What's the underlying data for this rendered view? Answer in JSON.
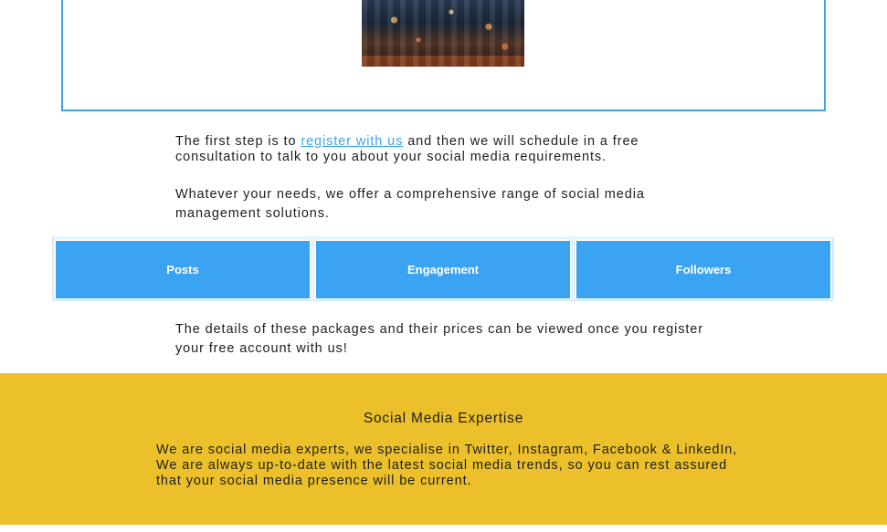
{
  "hero": {
    "image_alt": "city-night-photo"
  },
  "intro": {
    "p1_before": "The first step is to ",
    "p1_link": "register with us",
    "p1_after": " and then we will schedule in a free consultation to talk to you about your social media requirements.",
    "p2": "Whatever your needs, we offer a comprehensive range of social media management solutions."
  },
  "packages": {
    "items": [
      {
        "label": "Posts"
      },
      {
        "label": "Engagement"
      },
      {
        "label": "Followers"
      }
    ],
    "note": "The details of these packages and their prices can be viewed once you register your free account with us!"
  },
  "expertise": {
    "title": "Social Media Expertise",
    "text": "We are social media experts, we specialise in Twitter, Instagram, Facebook & LinkedIn, We are always up-to-date with the latest social media trends, so you can rest assured that your social media presence will be current."
  },
  "colors": {
    "accent_blue": "#3ba4f2",
    "link_blue": "#3ba4ea",
    "section_yellow": "#ecc02a"
  }
}
